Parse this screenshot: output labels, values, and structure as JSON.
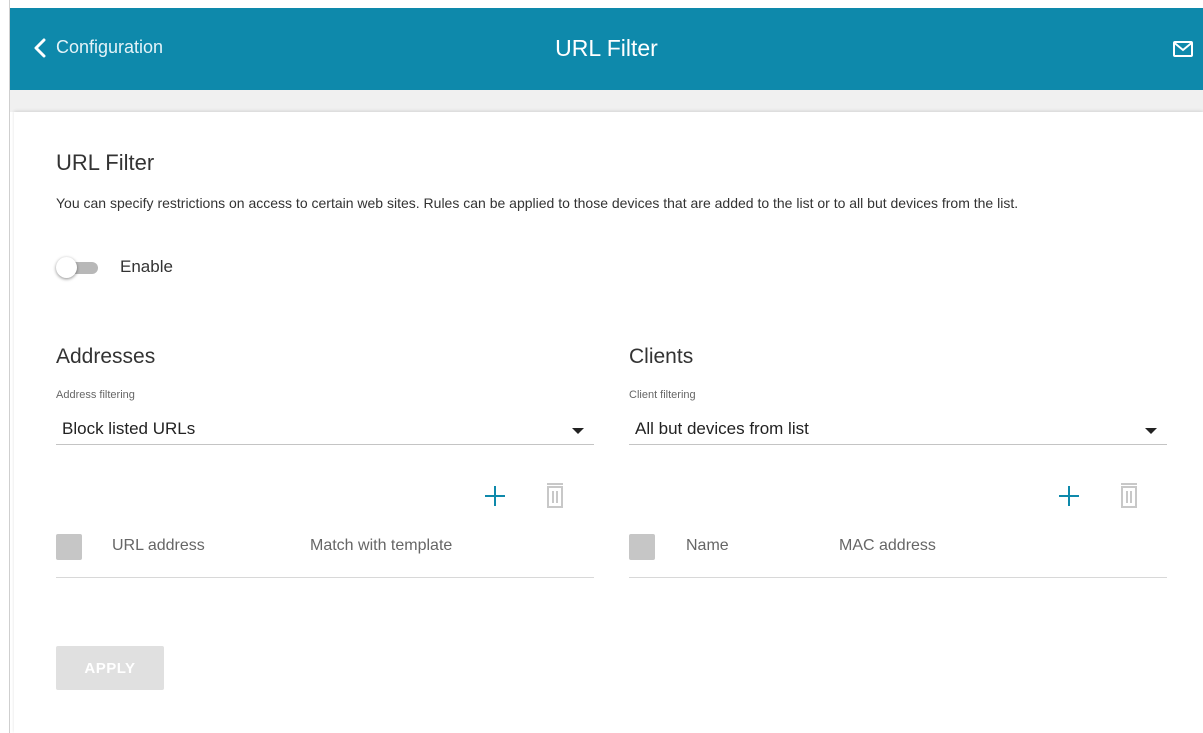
{
  "header": {
    "back_label": "Configuration",
    "title": "URL Filter",
    "back_icon": "chevron-left",
    "notifications_icon": "mail"
  },
  "main": {
    "heading": "URL Filter",
    "description": "You can specify restrictions on access to certain web sites. Rules can be applied to those devices that are added to the list or to all but devices from the list.",
    "enable_label": "Enable",
    "enable_on": false
  },
  "addresses": {
    "title": "Addresses",
    "filter_label": "Address filtering",
    "filter_value": "Block listed URLs",
    "columns": [
      "URL address",
      "Match with template"
    ],
    "rows": []
  },
  "clients": {
    "title": "Clients",
    "filter_label": "Client filtering",
    "filter_value": "All but devices from list",
    "columns": [
      "Name",
      "MAC address"
    ],
    "rows": []
  },
  "apply_label": "APPLY",
  "colors": {
    "header_bg": "#0e89ab",
    "accent": "#0e89ab",
    "disabled": "#e0e0e0"
  }
}
